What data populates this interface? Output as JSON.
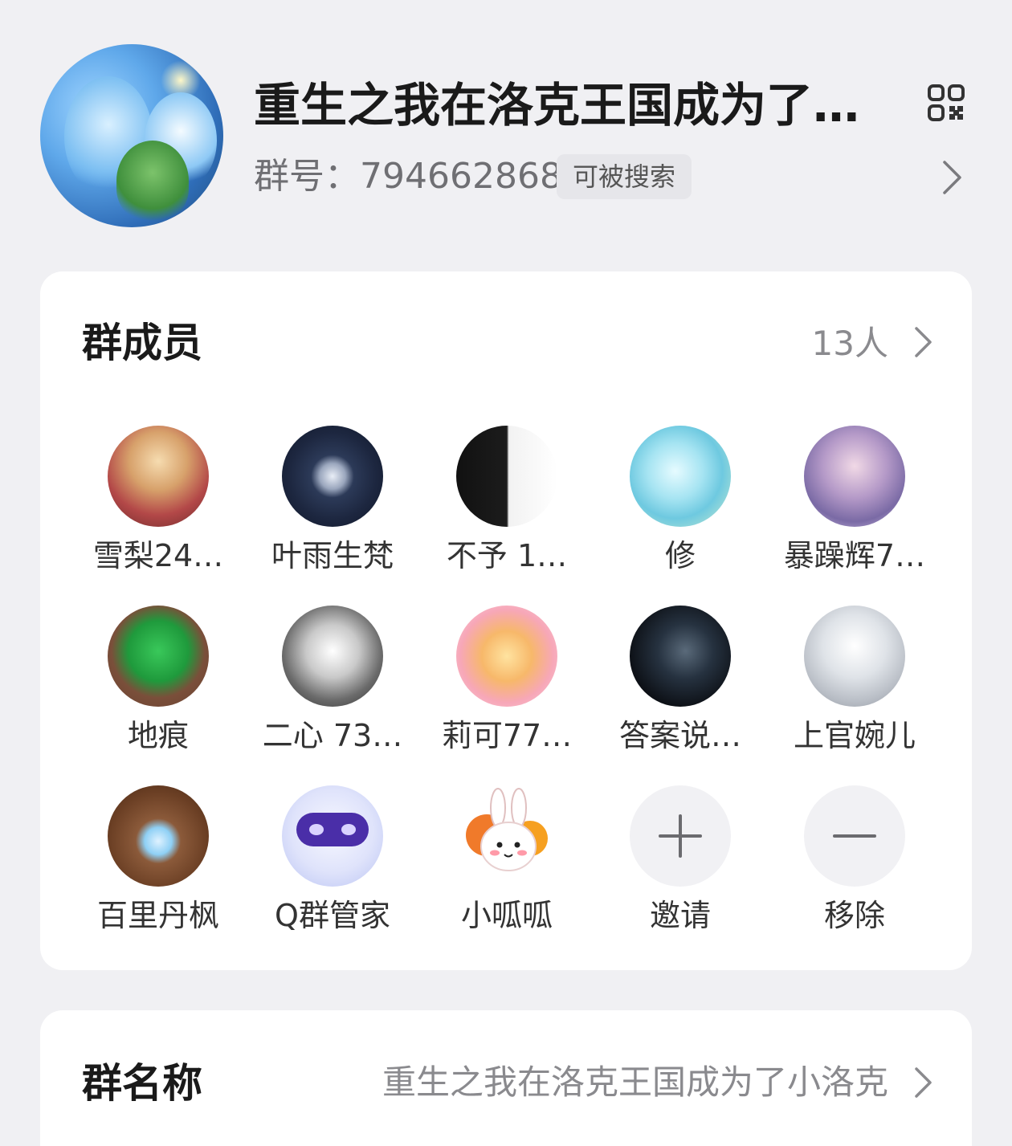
{
  "header": {
    "group_title": "重生之我在洛克王国成为了…",
    "group_id_label": "群号：",
    "group_id": "794662868",
    "search_badge": "可被搜索",
    "qr_icon": "qr-code-icon",
    "chevron_icon": "chevron-right-icon"
  },
  "members": {
    "title": "群成员",
    "count": "13人",
    "chevron_icon": "chevron-right-icon",
    "list": [
      {
        "name": "雪梨24…"
      },
      {
        "name": "叶雨生梵"
      },
      {
        "name": "不予  1…"
      },
      {
        "name": "修"
      },
      {
        "name": "暴躁辉7…"
      },
      {
        "name": "地痕"
      },
      {
        "name": "二心 73…"
      },
      {
        "name": "莉可77…"
      },
      {
        "name": "答案说…"
      },
      {
        "name": "上官婉儿"
      },
      {
        "name": "百里丹枫"
      },
      {
        "name": "Q群管家"
      },
      {
        "name": "小呱呱"
      }
    ],
    "invite_label": "邀请",
    "remove_label": "移除",
    "invite_icon": "plus-icon",
    "remove_icon": "minus-icon"
  },
  "group_name_row": {
    "title": "群名称",
    "value": "重生之我在洛克王国成为了小洛克",
    "chevron_icon": "chevron-right-icon"
  },
  "colors": {
    "background": "#f0f0f3",
    "card": "#ffffff",
    "primary_text": "#1a1a1a",
    "secondary_text": "#8a8a8e",
    "badge_bg": "#e6e6ea"
  }
}
